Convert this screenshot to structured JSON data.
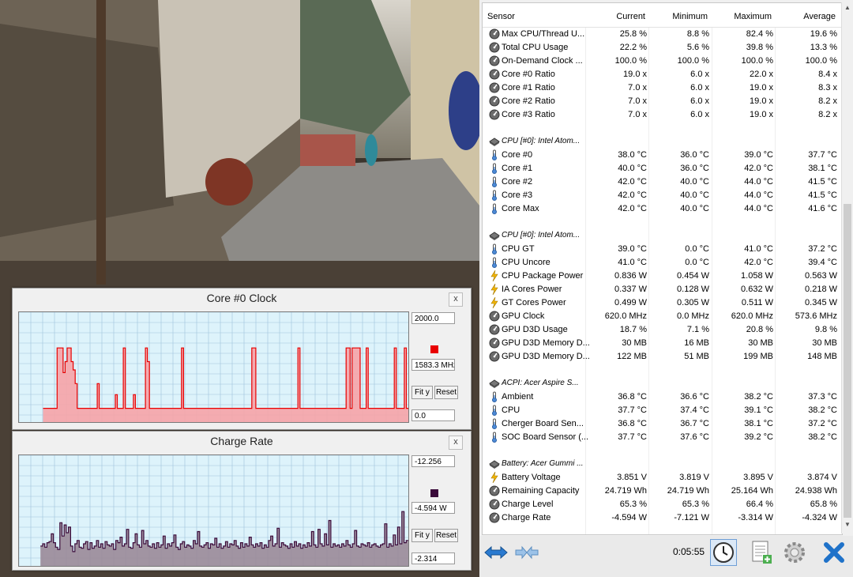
{
  "graphs": {
    "clock": {
      "title": "Core #0 Clock",
      "close": "x",
      "max_value": "2000.0",
      "current_value": "1583.3 MHz",
      "min_value": "0.0",
      "fit_label": "Fit y",
      "reset_label": "Reset",
      "color": "#e80000",
      "fill": "#f6a3a7",
      "ylim": [
        0,
        2000
      ],
      "start_index": 12,
      "baseline": 250,
      "values": [
        0,
        0,
        0,
        0,
        0,
        0,
        0,
        0,
        0,
        0,
        0,
        0,
        250,
        250,
        250,
        250,
        250,
        250,
        250,
        1350,
        1350,
        1350,
        900,
        1100,
        1350,
        1350,
        1100,
        950,
        700,
        250,
        250,
        250,
        250,
        250,
        250,
        250,
        250,
        250,
        250,
        700,
        250,
        250,
        250,
        250,
        250,
        250,
        250,
        250,
        500,
        250,
        250,
        250,
        1350,
        250,
        250,
        250,
        250,
        500,
        250,
        250,
        250,
        250,
        250,
        1350,
        1100,
        250,
        250,
        250,
        250,
        250,
        250,
        250,
        250,
        250,
        250,
        250,
        250,
        250,
        250,
        250,
        250,
        1350,
        250,
        250,
        250,
        250,
        250,
        250,
        250,
        250,
        250,
        250,
        250,
        250,
        250,
        250,
        250,
        250,
        250,
        250,
        250,
        250,
        250,
        250,
        250,
        250,
        250,
        250,
        250,
        250,
        250,
        250,
        250,
        250,
        250,
        250,
        1350,
        1350,
        250,
        250,
        250,
        250,
        250,
        250,
        250,
        250,
        250,
        250,
        250,
        250,
        250,
        250,
        250,
        250,
        250,
        250,
        250,
        250,
        250,
        1350,
        250,
        250,
        250,
        250,
        250,
        250,
        250,
        250,
        250,
        250,
        250,
        250,
        250,
        250,
        250,
        250,
        250,
        250,
        250,
        250,
        250,
        250,
        250,
        1350,
        1350,
        250,
        1350,
        1350,
        1350,
        1350,
        250,
        250,
        250,
        1350,
        250,
        250,
        250,
        250,
        250,
        250,
        250,
        250,
        250,
        250,
        250,
        250,
        250,
        1350,
        250,
        250,
        250,
        250,
        1350,
        250
      ]
    },
    "charge": {
      "title": "Charge Rate",
      "close": "x",
      "max_value": "-12.256",
      "current_value": "-4.594 W",
      "min_value": "-2.314",
      "fit_label": "Fit y",
      "reset_label": "Reset",
      "color": "#3a0a3a",
      "fill": "#9a8a98",
      "ylim": [
        -2.314,
        -12.256
      ],
      "start_index": 10,
      "values": [
        -4.1,
        -4.3,
        -4.2,
        -4.3,
        -4.2,
        -4.1,
        -4.3,
        -4.2,
        -4.3,
        -4.2,
        -4.1,
        -4.3,
        -4.0,
        -4.4,
        -4.5,
        -5.2,
        -4.4,
        -4.0,
        -3.8,
        -6.2,
        -5.0,
        -6.0,
        -5.3,
        -5.8,
        -4.1,
        -3.6,
        -4.3,
        -4.6,
        -4.0,
        -3.9,
        -4.3,
        -4.5,
        -3.8,
        -4.4,
        -3.9,
        -4.1,
        -4.6,
        -4.0,
        -4.3,
        -3.9,
        -4.5,
        -4.2,
        -4.1,
        -4.3,
        -3.8,
        -4.6,
        -4.4,
        -4.9,
        -4.1,
        -4.3,
        -5.6,
        -4.0,
        -3.9,
        -4.4,
        -5.2,
        -4.2,
        -4.0,
        -5.5,
        -4.3,
        -4.6,
        -4.1,
        -4.0,
        -4.3,
        -3.9,
        -4.4,
        -4.0,
        -4.2,
        -5.0,
        -3.9,
        -4.3,
        -4.1,
        -4.4,
        -5.1,
        -4.0,
        -3.8,
        -4.3,
        -4.5,
        -4.0,
        -4.2,
        -4.1,
        -3.9,
        -4.6,
        -4.3,
        -5.4,
        -4.1,
        -4.0,
        -4.2,
        -4.4,
        -3.9,
        -4.3,
        -4.2,
        -4.8,
        -4.0,
        -4.3,
        -3.9,
        -4.1,
        -4.5,
        -4.0,
        -4.3,
        -4.2,
        -4.6,
        -4.1,
        -3.9,
        -4.4,
        -4.0,
        -4.3,
        -4.1,
        -4.9,
        -4.2,
        -4.0,
        -4.3,
        -4.1,
        -4.4,
        -3.9,
        -4.2,
        -4.0,
        -4.6,
        -5.0,
        -4.1,
        -4.3,
        -5.7,
        -4.0,
        -4.4,
        -4.2,
        -4.1,
        -3.9,
        -4.3,
        -4.0,
        -4.5,
        -4.1,
        -4.3,
        -3.9,
        -4.2,
        -4.0,
        -4.4,
        -4.1,
        -5.4,
        -4.2,
        -4.0,
        -5.6,
        -4.3,
        -4.1,
        -5.2,
        -4.2,
        -6.4,
        -4.0,
        -4.3,
        -4.1,
        -4.2,
        -4.0,
        -4.3,
        -4.1,
        -4.6,
        -4.2,
        -4.0,
        -4.3,
        -5.5,
        -4.1,
        -4.0,
        -4.3,
        -4.2,
        -4.1,
        -4.4,
        -4.0,
        -4.2,
        -4.3,
        -4.1,
        -4.0,
        -4.2,
        -4.3,
        -6.1,
        -4.0,
        -4.3,
        -4.1,
        -5.1,
        -4.2,
        -5.8,
        -4.3,
        -7.2,
        -4.4,
        -4.6
      ]
    }
  },
  "table": {
    "headers": [
      "Sensor",
      "Current",
      "Minimum",
      "Maximum",
      "Average"
    ],
    "rows": [
      {
        "type": "row",
        "icon": "gauge-icon",
        "name": "Max CPU/Thread U...",
        "cur": "25.8 %",
        "min": "8.8 %",
        "max": "82.4 %",
        "avg": "19.6 %"
      },
      {
        "type": "row",
        "icon": "gauge-icon",
        "name": "Total CPU Usage",
        "cur": "22.2 %",
        "min": "5.6 %",
        "max": "39.8 %",
        "avg": "13.3 %"
      },
      {
        "type": "row",
        "icon": "gauge-icon",
        "name": "On-Demand Clock ...",
        "cur": "100.0 %",
        "min": "100.0 %",
        "max": "100.0 %",
        "avg": "100.0 %"
      },
      {
        "type": "row",
        "icon": "gauge-icon",
        "name": "Core #0 Ratio",
        "cur": "19.0 x",
        "min": "6.0 x",
        "max": "22.0 x",
        "avg": "8.4 x"
      },
      {
        "type": "row",
        "icon": "gauge-icon",
        "name": "Core #1 Ratio",
        "cur": "7.0 x",
        "min": "6.0 x",
        "max": "19.0 x",
        "avg": "8.3 x"
      },
      {
        "type": "row",
        "icon": "gauge-icon",
        "name": "Core #2 Ratio",
        "cur": "7.0 x",
        "min": "6.0 x",
        "max": "19.0 x",
        "avg": "8.2 x"
      },
      {
        "type": "row",
        "icon": "gauge-icon",
        "name": "Core #3 Ratio",
        "cur": "7.0 x",
        "min": "6.0 x",
        "max": "19.0 x",
        "avg": "8.2 x"
      },
      {
        "type": "blank"
      },
      {
        "type": "section",
        "icon": "chip-icon",
        "name": "CPU [#0]: Intel Atom..."
      },
      {
        "type": "row",
        "icon": "thermometer-icon",
        "name": "Core #0",
        "cur": "38.0 °C",
        "min": "36.0 °C",
        "max": "39.0 °C",
        "avg": "37.7 °C"
      },
      {
        "type": "row",
        "icon": "thermometer-icon",
        "name": "Core #1",
        "cur": "40.0 °C",
        "min": "36.0 °C",
        "max": "42.0 °C",
        "avg": "38.1 °C"
      },
      {
        "type": "row",
        "icon": "thermometer-icon",
        "name": "Core #2",
        "cur": "42.0 °C",
        "min": "40.0 °C",
        "max": "44.0 °C",
        "avg": "41.5 °C"
      },
      {
        "type": "row",
        "icon": "thermometer-icon",
        "name": "Core #3",
        "cur": "42.0 °C",
        "min": "40.0 °C",
        "max": "44.0 °C",
        "avg": "41.5 °C"
      },
      {
        "type": "row",
        "icon": "thermometer-icon",
        "name": "Core Max",
        "cur": "42.0 °C",
        "min": "40.0 °C",
        "max": "44.0 °C",
        "avg": "41.6 °C"
      },
      {
        "type": "blank"
      },
      {
        "type": "section",
        "icon": "chip-icon",
        "name": "CPU [#0]: Intel Atom..."
      },
      {
        "type": "row",
        "icon": "thermometer-icon",
        "name": "CPU GT",
        "cur": "39.0 °C",
        "min": "0.0 °C",
        "max": "41.0 °C",
        "avg": "37.2 °C"
      },
      {
        "type": "row",
        "icon": "thermometer-icon",
        "name": "CPU Uncore",
        "cur": "41.0 °C",
        "min": "0.0 °C",
        "max": "42.0 °C",
        "avg": "39.4 °C"
      },
      {
        "type": "row",
        "icon": "lightning-icon",
        "name": "CPU Package Power",
        "cur": "0.836 W",
        "min": "0.454 W",
        "max": "1.058 W",
        "avg": "0.563 W"
      },
      {
        "type": "row",
        "icon": "lightning-icon",
        "name": "IA Cores Power",
        "cur": "0.337 W",
        "min": "0.128 W",
        "max": "0.632 W",
        "avg": "0.218 W"
      },
      {
        "type": "row",
        "icon": "lightning-icon",
        "name": "GT Cores Power",
        "cur": "0.499 W",
        "min": "0.305 W",
        "max": "0.511 W",
        "avg": "0.345 W"
      },
      {
        "type": "row",
        "icon": "gauge-icon",
        "name": "GPU Clock",
        "cur": "620.0 MHz",
        "min": "0.0 MHz",
        "max": "620.0 MHz",
        "avg": "573.6 MHz"
      },
      {
        "type": "row",
        "icon": "gauge-icon",
        "name": "GPU D3D Usage",
        "cur": "18.7 %",
        "min": "7.1 %",
        "max": "20.8 %",
        "avg": "9.8 %"
      },
      {
        "type": "row",
        "icon": "gauge-icon",
        "name": "GPU D3D Memory D...",
        "cur": "30 MB",
        "min": "16 MB",
        "max": "30 MB",
        "avg": "30 MB"
      },
      {
        "type": "row",
        "icon": "gauge-icon",
        "name": "GPU D3D Memory D...",
        "cur": "122 MB",
        "min": "51 MB",
        "max": "199 MB",
        "avg": "148 MB"
      },
      {
        "type": "blank"
      },
      {
        "type": "section",
        "icon": "chip-icon",
        "name": "ACPI: Acer Aspire S..."
      },
      {
        "type": "row",
        "icon": "thermometer-icon",
        "name": "Ambient",
        "cur": "36.8 °C",
        "min": "36.6 °C",
        "max": "38.2 °C",
        "avg": "37.3 °C"
      },
      {
        "type": "row",
        "icon": "thermometer-icon",
        "name": "CPU",
        "cur": "37.7 °C",
        "min": "37.4 °C",
        "max": "39.1 °C",
        "avg": "38.2 °C"
      },
      {
        "type": "row",
        "icon": "thermometer-icon",
        "name": "Cherger Board Sen...",
        "cur": "36.8 °C",
        "min": "36.7 °C",
        "max": "38.1 °C",
        "avg": "37.2 °C"
      },
      {
        "type": "row",
        "icon": "thermometer-icon",
        "name": "SOC Board Sensor (...",
        "cur": "37.7 °C",
        "min": "37.6 °C",
        "max": "39.2 °C",
        "avg": "38.2 °C"
      },
      {
        "type": "blank"
      },
      {
        "type": "section",
        "icon": "chip-icon",
        "name": "Battery: Acer Gummi ..."
      },
      {
        "type": "row",
        "icon": "lightning-icon",
        "name": "Battery Voltage",
        "cur": "3.851 V",
        "min": "3.819 V",
        "max": "3.895 V",
        "avg": "3.874 V"
      },
      {
        "type": "row",
        "icon": "gauge-icon",
        "name": "Remaining Capacity",
        "cur": "24.719 Wh",
        "min": "24.719 Wh",
        "max": "25.164 Wh",
        "avg": "24.938 Wh"
      },
      {
        "type": "row",
        "icon": "gauge-icon",
        "name": "Charge Level",
        "cur": "65.3 %",
        "min": "65.3 %",
        "max": "66.4 %",
        "avg": "65.8 %"
      },
      {
        "type": "row",
        "icon": "gauge-icon",
        "name": "Charge Rate",
        "cur": "-4.594 W",
        "min": "-7.121 W",
        "max": "-3.314 W",
        "avg": "-4.324 W"
      }
    ]
  },
  "bottom": {
    "timer": "0:05:55",
    "buttons": [
      "expand-arrows-icon",
      "collapse-arrows-icon",
      "clock-icon",
      "report-icon",
      "settings-gear-icon",
      "close-x-icon"
    ]
  },
  "colors": {
    "panel_bg": "#f0f0f0",
    "plot_bg": "#ddf3fb",
    "grid": "#9fc3db",
    "accent_blue": "#2a7ad0"
  }
}
